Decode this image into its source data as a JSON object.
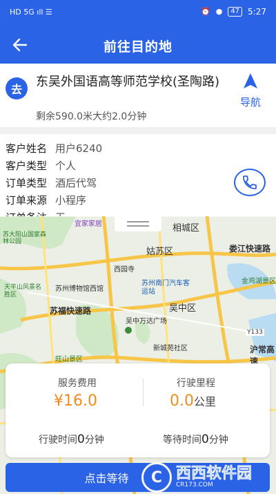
{
  "statusbar": {
    "time": "5:27",
    "battery": "47",
    "left_icons": "HD 5G ıll ☰"
  },
  "appbar": {
    "title": "前往目的地"
  },
  "destination": {
    "badge": "去",
    "name": "东吴外国语高等师范学校(圣陶路)",
    "remain": "剩余590.0米大约2.0分钟",
    "nav_label": "导航"
  },
  "customer": {
    "rows": [
      {
        "key": "客户姓名",
        "value": "用户6240"
      },
      {
        "key": "客户类型",
        "value": "个人"
      },
      {
        "key": "订单类型",
        "value": "酒后代驾"
      },
      {
        "key": "订单来源",
        "value": "小程序"
      },
      {
        "key": "订单备注",
        "value": "无"
      }
    ]
  },
  "map": {
    "labels": [
      {
        "text": "宜家家居"
      },
      {
        "text": "苏大阳山国家森林公园"
      },
      {
        "text": "相城区"
      },
      {
        "text": "姑苏区"
      },
      {
        "text": "娄江快速路"
      },
      {
        "text": "西园寺"
      },
      {
        "text": "金鸡湖景区"
      },
      {
        "text": "天平山风景名胜区"
      },
      {
        "text": "苏州博物馆西馆"
      },
      {
        "text": "苏州南门汽车客运站"
      },
      {
        "text": "吴中区"
      },
      {
        "text": "苏福快速路"
      },
      {
        "text": "吴中万达广场"
      },
      {
        "text": "新城苑社区"
      },
      {
        "text": "旺山景区"
      },
      {
        "text": "沪常高速"
      },
      {
        "text": "Y133"
      }
    ]
  },
  "fare": {
    "fee_label": "服务费用",
    "fee_value": "¥16.0",
    "distance_label": "行驶里程",
    "distance_value": "0.0",
    "distance_unit": "公里",
    "drive_time_label": "行驶时间",
    "drive_time_value": "0",
    "drive_time_unit": "分钟",
    "wait_time_label": "等待时间",
    "wait_time_value": "0",
    "wait_time_unit": "分钟"
  },
  "action": {
    "button_label": "点击等待"
  },
  "watermark": {
    "brand": "西西软件园",
    "url": "CR173.COM"
  },
  "colors": {
    "primary": "#2b63e6",
    "accent": "#f08c1e"
  }
}
